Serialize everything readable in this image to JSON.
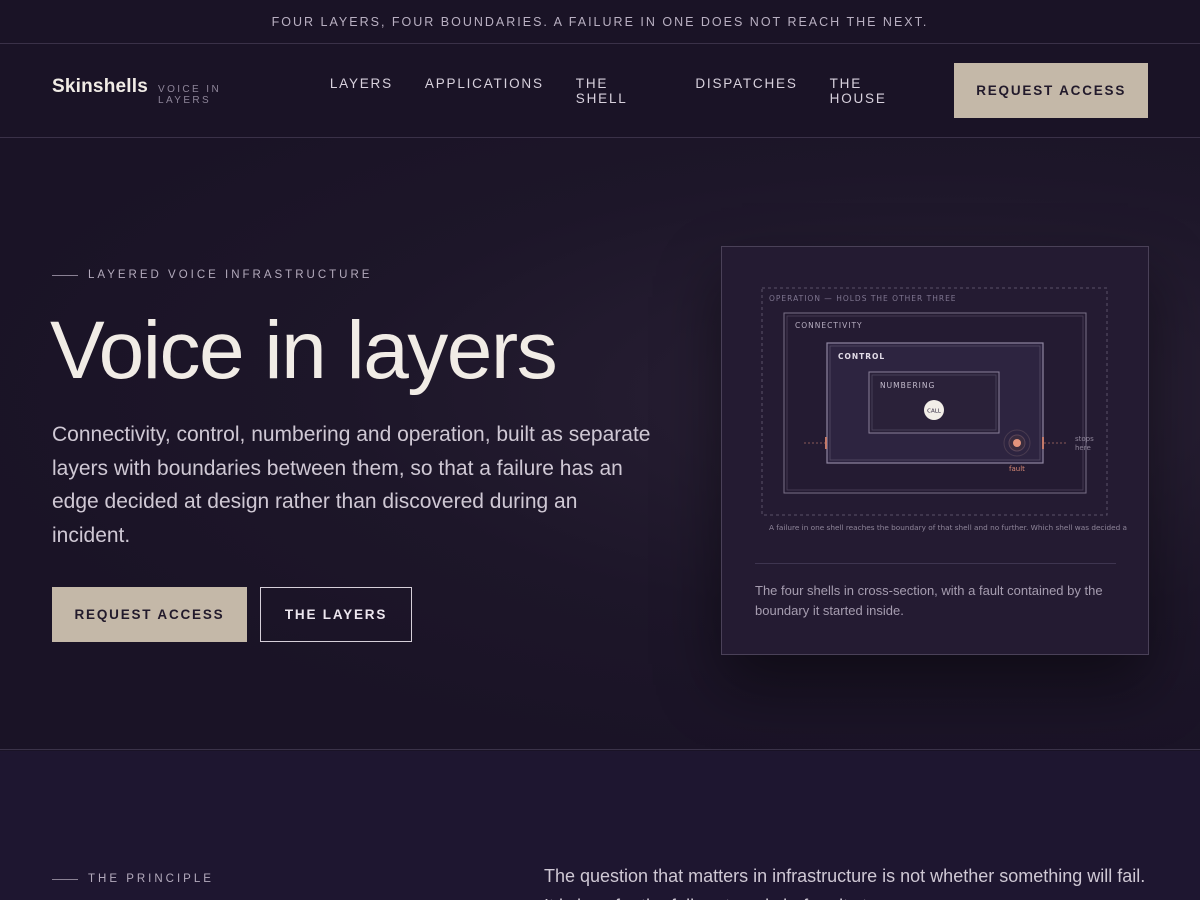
{
  "topbar": {
    "text": "FOUR LAYERS, FOUR BOUNDARIES. A FAILURE IN ONE DOES NOT REACH THE NEXT."
  },
  "brand": {
    "name": "Skinshells",
    "tagline": "VOICE IN LAYERS"
  },
  "nav": {
    "links": [
      "LAYERS",
      "APPLICATIONS",
      "THE SHELL",
      "DISPATCHES",
      "THE HOUSE"
    ],
    "cta": "REQUEST ACCESS"
  },
  "hero": {
    "eyebrow": "LAYERED VOICE INFRASTRUCTURE",
    "title": "Voice in layers",
    "body": "Connectivity, control, numbering and operation, built as separate layers with boundaries between them, so that a failure has an edge decided at design rather than discovered during an incident.",
    "primary_button": "REQUEST ACCESS",
    "secondary_button": "THE LAYERS"
  },
  "figure": {
    "labels": {
      "operation": "OPERATION — HOLDS THE OTHER THREE",
      "connectivity": "CONNECTIVITY",
      "control": "CONTROL",
      "numbering": "NUMBERING",
      "call": "CALL",
      "fault": "fault",
      "stops_1": "stops",
      "stops_2": "here"
    },
    "note": "A failure in one shell reaches the boundary of that shell and no further. Which shell was decided a",
    "caption": "The four shells in cross-section, with a fault contained by the boundary it started inside."
  },
  "principle": {
    "eyebrow": "THE PRINCIPLE",
    "text": "The question that matters in infrastructure is not whether something will fail. It is how far the failure travels before it stops."
  },
  "colors": {
    "background": "#1a1326",
    "accent": "#c4b8a8",
    "fault": "#e2937c",
    "panel": "#241b32"
  }
}
